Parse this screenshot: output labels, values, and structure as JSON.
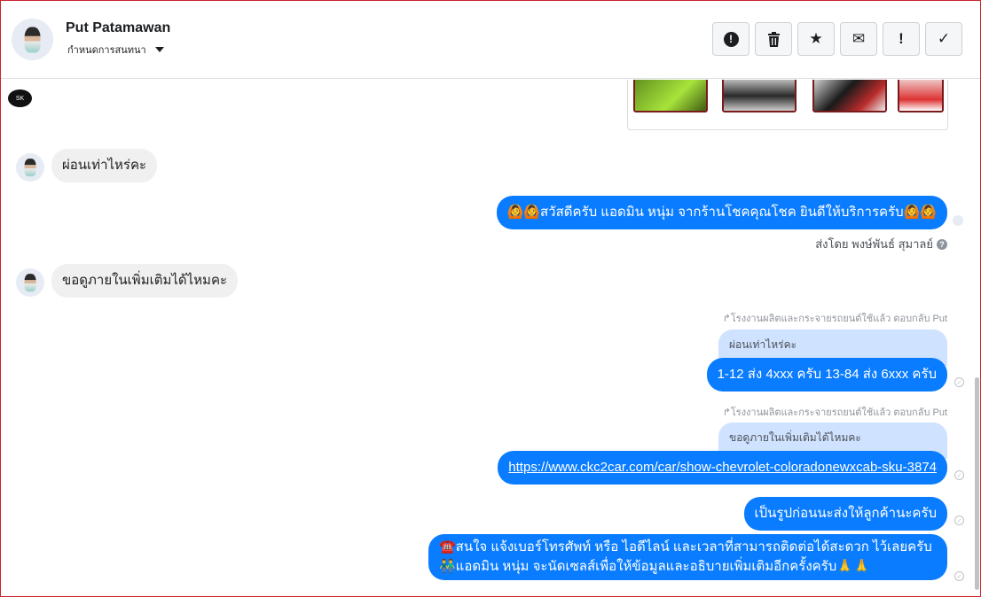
{
  "header": {
    "name": "Put Patamawan",
    "subtitle": "กำหนดการสนทนา",
    "toolbar": [
      {
        "icon": "alert-circle-icon",
        "glyph": "!"
      },
      {
        "icon": "trash-icon",
        "glyph": "🗑"
      },
      {
        "icon": "star-icon",
        "glyph": "★"
      },
      {
        "icon": "mail-icon",
        "glyph": "✉"
      },
      {
        "icon": "exclamation-icon",
        "glyph": "!"
      },
      {
        "icon": "check-icon",
        "glyph": "✓"
      }
    ]
  },
  "messages": {
    "incoming_1": "ผ่อนเท่าไหร่คะ",
    "outgoing_1": "🙆🙆สวัสดีครับ แอดมิน หนุ่ม จากร้านโชคคุณโชค ยินดีให้บริการครับ🙆🙆",
    "sent_by": "ส่งโดย พงษ์พันธ์ สุมาลย์",
    "incoming_2": "ขอดูภายในเพิ่มเติมได้ไหมคะ",
    "reply_meta_1": "↱โรงงานผลิตและกระจายรถยนต์ใช้แล้ว ตอบกลับ Put",
    "quote_1": "ผ่อนเท่าไหร่คะ",
    "outgoing_2": "1-12 ส่ง 4xxx ครับ 13-84 ส่ง 6xxx ครับ",
    "reply_meta_2": "↱โรงงานผลิตและกระจายรถยนต์ใช้แล้ว ตอบกลับ Put",
    "quote_2": "ขอดูภายในเพิ่มเติมได้ไหมคะ",
    "outgoing_link": "https://www.ckc2car.com/car/show-chevrolet-coloradonewxcab-sku-3874",
    "outgoing_3": "เป็นรูปก่อนนะส่งให้ลูกค้านะครับ",
    "outgoing_4_line1": "☎️สนใจ แจ้งเบอร์โทรศัพท์ หรือ ไอดีไลน์ และเวลาที่สามารถติดต่อได้สะดวก ไว้เลยครับ",
    "outgoing_4_line2": "👬แอดมิน หนุ่ม จะนัดเซลส์เพื่อให้ข้อมูลและอธิบายเพิ่มเติมอีกครั้งครับ🙏🙏"
  },
  "colors": {
    "outgoing": "#0a7cff",
    "incoming": "#f1f0f0",
    "quote": "#cfe2ff"
  }
}
